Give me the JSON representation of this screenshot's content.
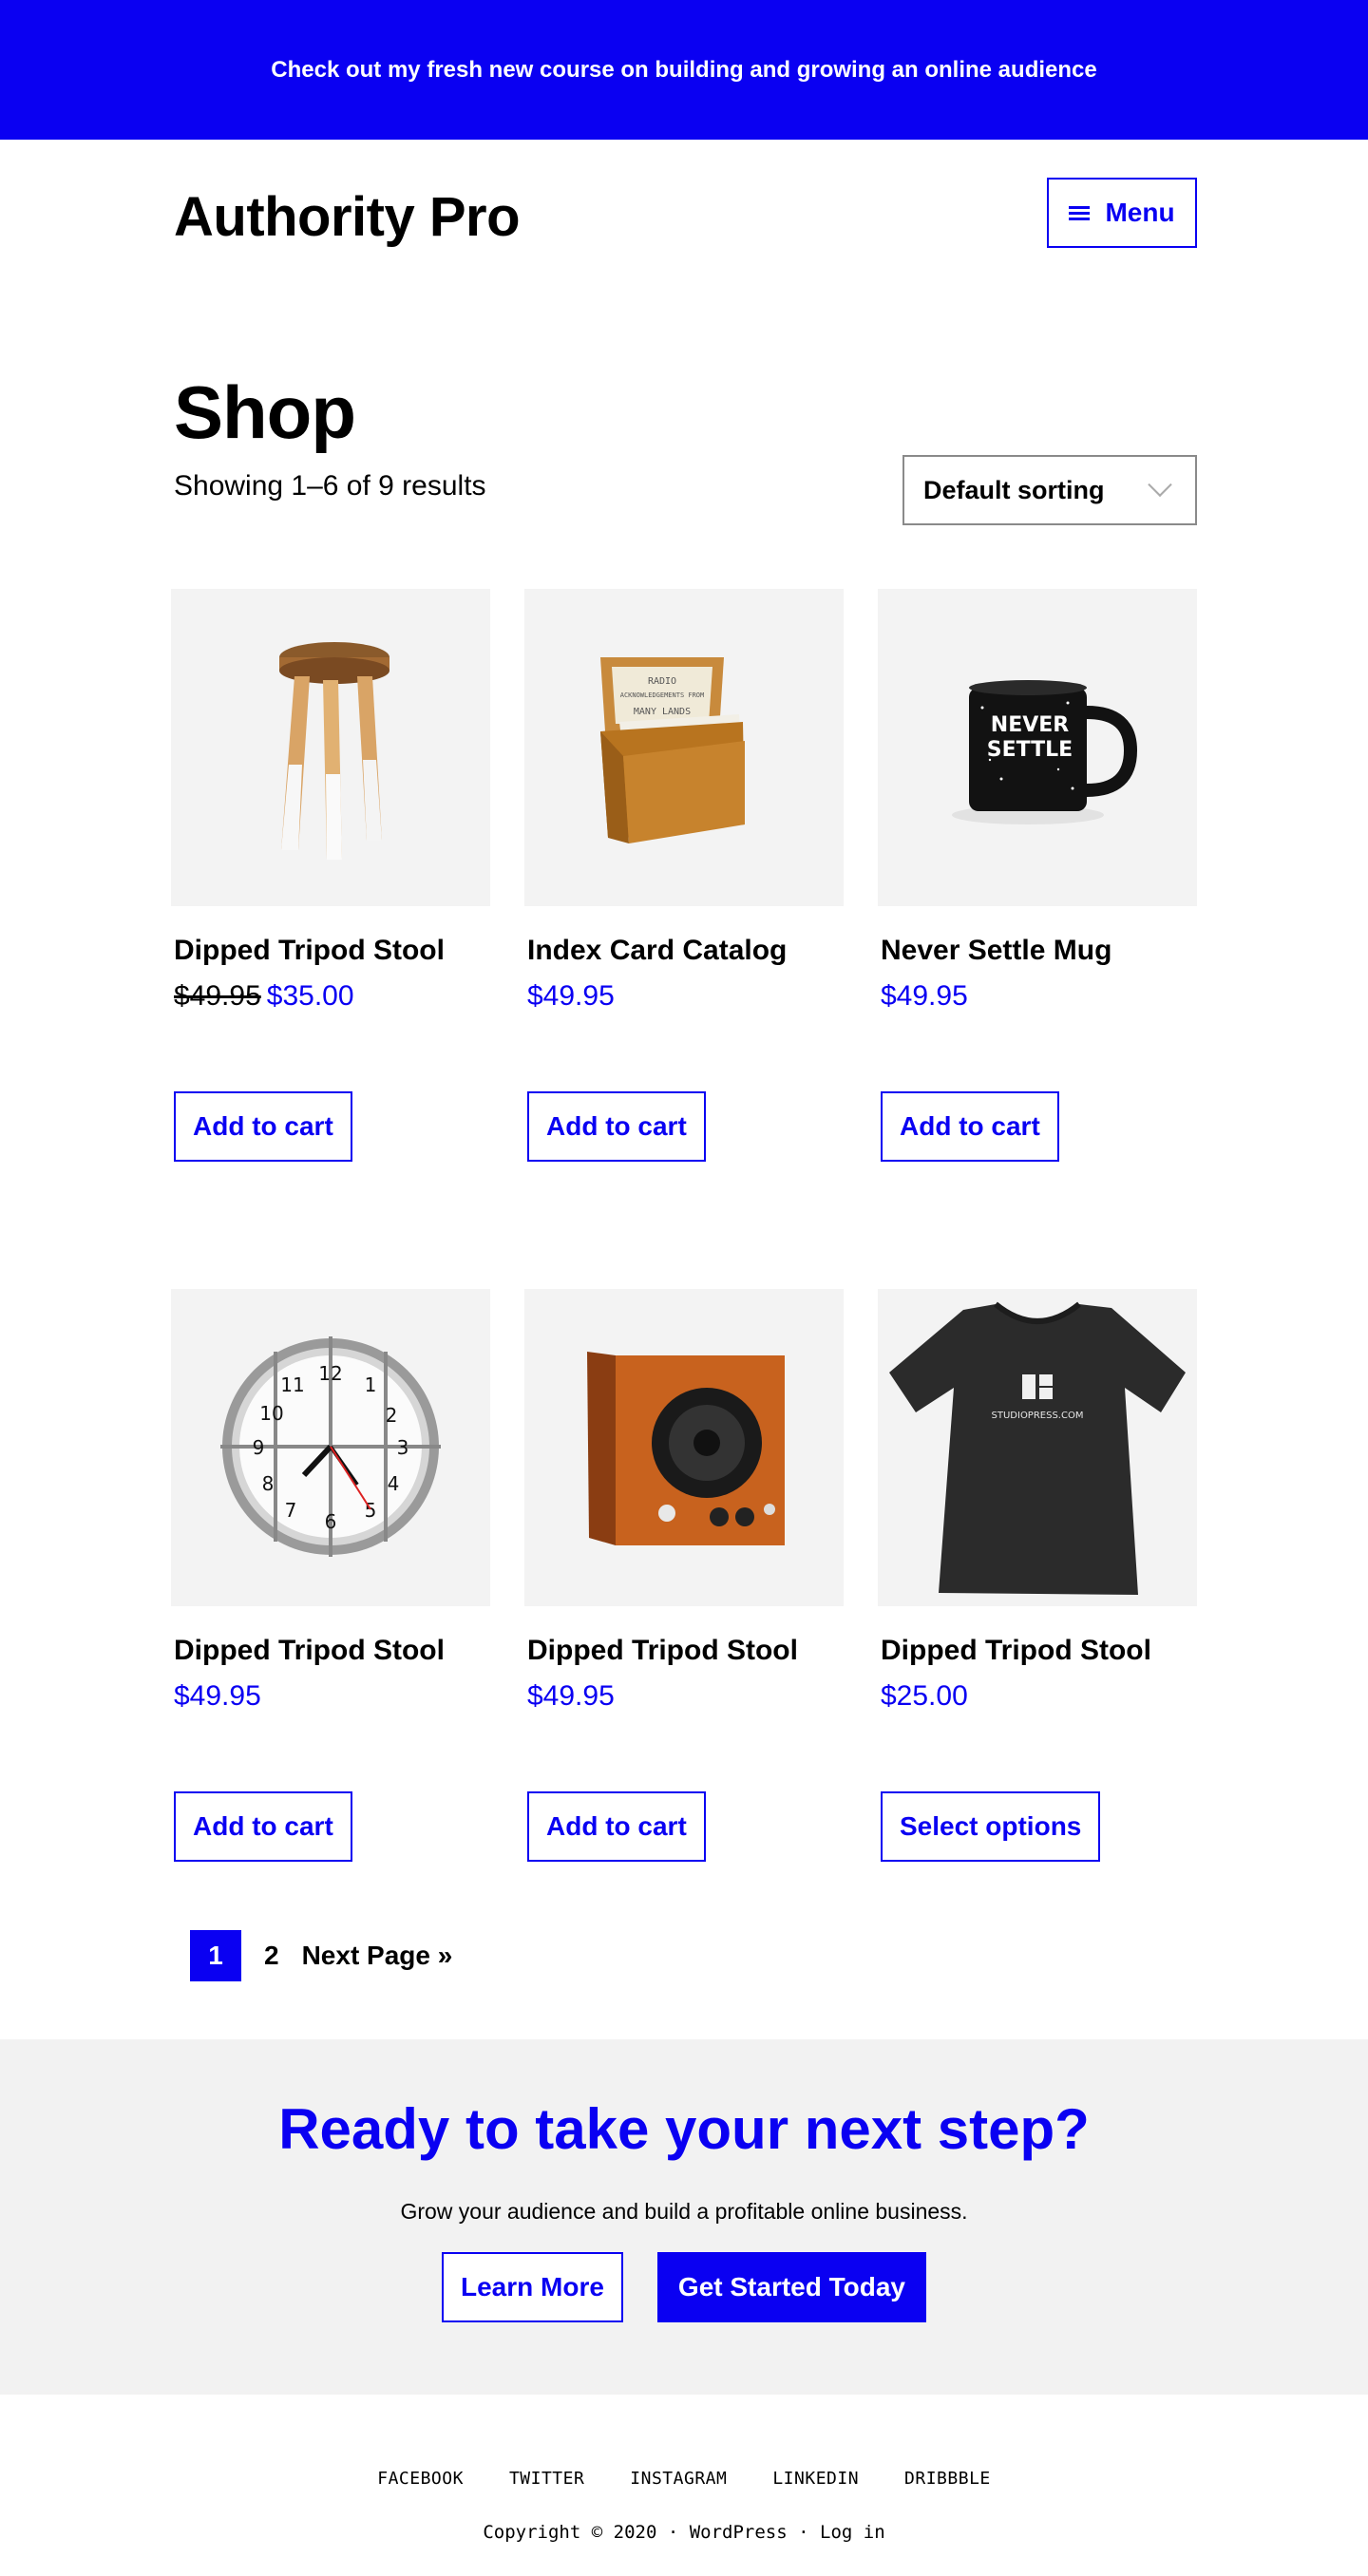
{
  "announcement": {
    "text": "Check out my fresh new course on building and growing an online audience"
  },
  "header": {
    "site_title": "Authority Pro",
    "menu_label": "Menu"
  },
  "shop": {
    "title": "Shop",
    "results_text": "Showing 1–6 of 9 results",
    "sort_selected": "Default sorting"
  },
  "products": [
    {
      "name": "Dipped Tripod Stool",
      "old_price": "$49.95",
      "price": "$35.00",
      "button": "Add to cart",
      "image_icon": "stool-image"
    },
    {
      "name": "Index Card Catalog",
      "old_price": "",
      "price": "$49.95",
      "button": "Add to cart",
      "image_icon": "card-box-image"
    },
    {
      "name": "Never Settle Mug",
      "old_price": "",
      "price": "$49.95",
      "button": "Add to cart",
      "image_icon": "mug-image"
    },
    {
      "name": "Dipped Tripod Stool",
      "old_price": "",
      "price": "$49.95",
      "button": "Add to cart",
      "image_icon": "clock-image"
    },
    {
      "name": "Dipped Tripod Stool",
      "old_price": "",
      "price": "$49.95",
      "button": "Add to cart",
      "image_icon": "speaker-image"
    },
    {
      "name": "Dipped Tripod Stool",
      "old_price": "",
      "price": "$25.00",
      "button": "Select options",
      "image_icon": "tshirt-image"
    }
  ],
  "image_text": {
    "card_box": [
      "RADIO",
      "ACKNOWLEDGEMENTS FROM",
      "MANY LANDS"
    ],
    "mug": [
      "NEVER",
      "SETTLE"
    ],
    "clock": [
      "12",
      "1",
      "2",
      "3",
      "4",
      "5",
      "6",
      "7",
      "8",
      "9",
      "10",
      "11"
    ],
    "tshirt": "STUDIOPRESS.COM"
  },
  "pagination": {
    "current": "1",
    "next_num": "2",
    "next_label": "Next Page »"
  },
  "cta": {
    "title": "Ready to take your next step?",
    "subtitle": "Grow your audience and build a profitable online business.",
    "learn_more": "Learn More",
    "get_started": "Get Started Today"
  },
  "footer": {
    "social": [
      "FACEBOOK",
      "TWITTER",
      "INSTAGRAM",
      "LINKEDIN",
      "DRIBBBLE"
    ],
    "copyright": "Copyright © 2020",
    "sep1": " · ",
    "wordpress": "WordPress",
    "sep2": " · ",
    "login": "Log in"
  },
  "colors": {
    "accent": "#0a00f2",
    "cta_bg": "#f2f2f2",
    "image_bg": "#f3f3f3"
  }
}
